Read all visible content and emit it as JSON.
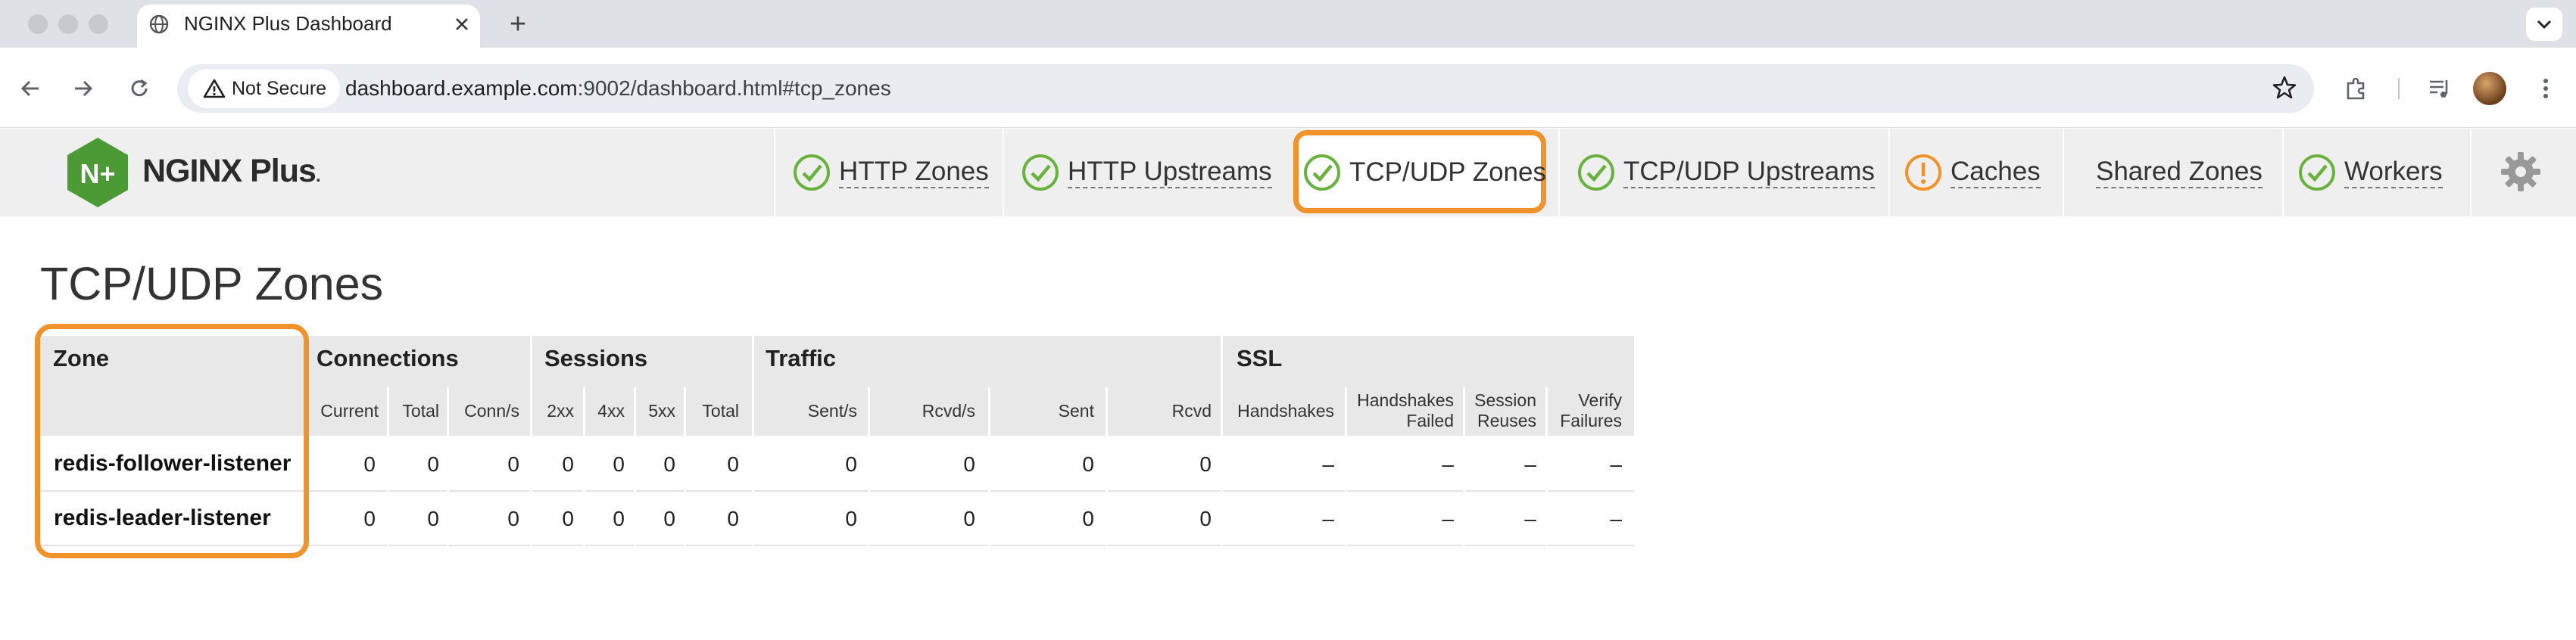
{
  "browser": {
    "tab_title": "NGINX Plus Dashboard",
    "new_tab_label": "+",
    "security_label": "Not Secure",
    "url_host": "dashboard.example.com",
    "url_rest": ":9002/dashboard.html#tcp_zones"
  },
  "app": {
    "logo_text": "NGINX Plus",
    "logo_mark": "N+",
    "nav": [
      {
        "label": "HTTP Zones",
        "status": "ok-icon"
      },
      {
        "label": "HTTP Upstreams",
        "status": "ok-icon"
      },
      {
        "label": "TCP/UDP Zones",
        "status": "ok-icon",
        "active": true
      },
      {
        "label": "TCP/UDP Upstreams",
        "status": "ok-icon"
      },
      {
        "label": "Caches",
        "status": "warning-icon"
      },
      {
        "label": "Shared Zones",
        "status": "none"
      },
      {
        "label": "Workers",
        "status": "ok-icon"
      }
    ],
    "colors": {
      "ok": "#6ab23e",
      "warn": "#f0932b",
      "highlight": "#f0932b",
      "logo": "#4b9a36"
    }
  },
  "page": {
    "title": "TCP/UDP Zones"
  },
  "table": {
    "groups": {
      "zone": "Zone",
      "connections": "Connections",
      "sessions": "Sessions",
      "traffic": "Traffic",
      "ssl": "SSL"
    },
    "columns": {
      "current": "Current",
      "total": "Total",
      "conn_s": "Conn/s",
      "s2xx": "2xx",
      "s4xx": "4xx",
      "s5xx": "5xx",
      "s_total": "Total",
      "sent_s": "Sent/s",
      "rcvd_s": "Rcvd/s",
      "sent": "Sent",
      "rcvd": "Rcvd",
      "handshakes": "Handshakes",
      "handshakes_failed_1": "Handshakes",
      "handshakes_failed_2": "Failed",
      "session_reuses_1": "Session",
      "session_reuses_2": "Reuses",
      "verify_failures_1": "Verify",
      "verify_failures_2": "Failures"
    },
    "rows": [
      {
        "zone": "redis-follower-listener",
        "current": "0",
        "total": "0",
        "conn_s": "0",
        "s2xx": "0",
        "s4xx": "0",
        "s5xx": "0",
        "s_total": "0",
        "sent_s": "0",
        "rcvd_s": "0",
        "sent": "0",
        "rcvd": "0",
        "handshakes": "–",
        "handshakes_failed": "–",
        "session_reuses": "–",
        "verify_failures": "–"
      },
      {
        "zone": "redis-leader-listener",
        "current": "0",
        "total": "0",
        "conn_s": "0",
        "s2xx": "0",
        "s4xx": "0",
        "s5xx": "0",
        "s_total": "0",
        "sent_s": "0",
        "rcvd_s": "0",
        "sent": "0",
        "rcvd": "0",
        "handshakes": "–",
        "handshakes_failed": "–",
        "session_reuses": "–",
        "verify_failures": "–"
      }
    ]
  }
}
